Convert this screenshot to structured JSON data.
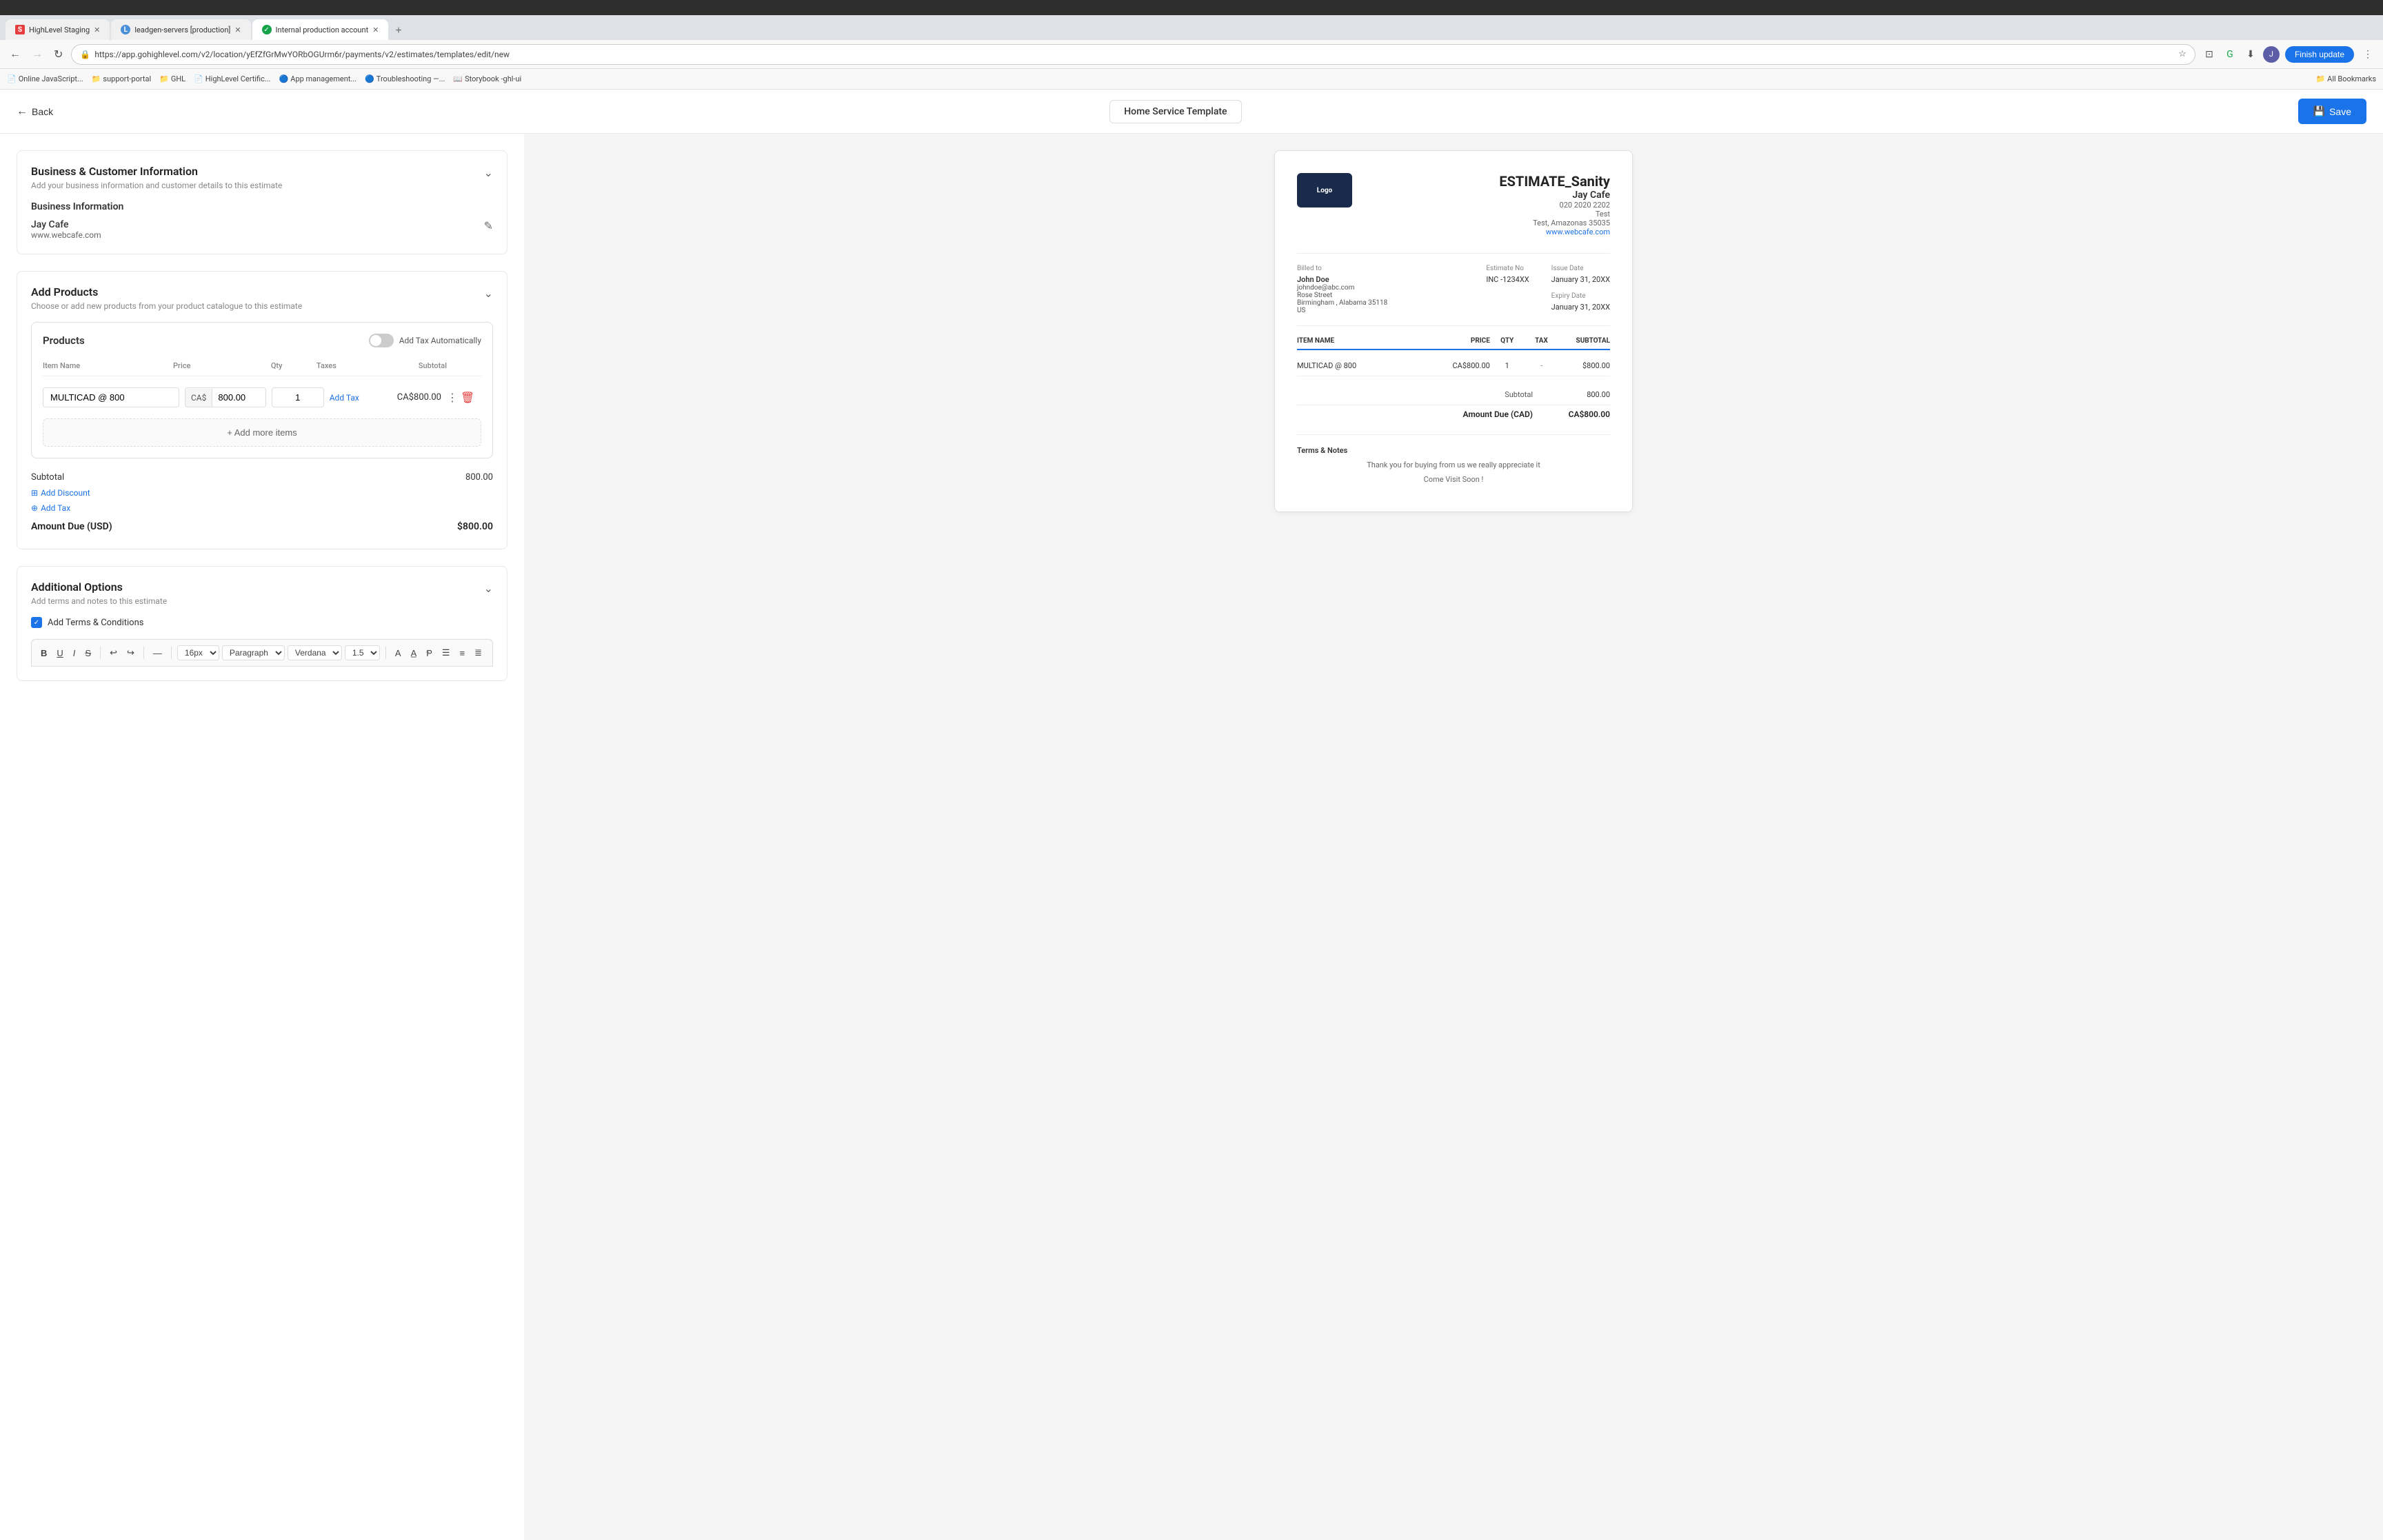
{
  "browser": {
    "tabs": [
      {
        "id": "tab1",
        "favicon": "S",
        "favicon_color": "#e53e3e",
        "label": "HighLevel Staging",
        "active": false
      },
      {
        "id": "tab2",
        "favicon": "L",
        "favicon_color": "#4a90d9",
        "label": "leadgen-servers [production]",
        "active": false
      },
      {
        "id": "tab3",
        "favicon": "✓",
        "favicon_color": "#16a34a",
        "label": "Internal production account",
        "active": true
      }
    ],
    "url": "https://app.gohighlevel.com/v2/location/yEfZfGrMwYORbOGUrm6r/payments/v2/estimates/templates/edit/new",
    "finish_update_label": "Finish update"
  },
  "bookmarks": [
    {
      "label": "Online JavaScript...",
      "icon": "📄"
    },
    {
      "label": "support-portal",
      "icon": "📁"
    },
    {
      "label": "GHL",
      "icon": "📁"
    },
    {
      "label": "HighLevel Certific...",
      "icon": "📄"
    },
    {
      "label": "App management...",
      "icon": "🔵"
    },
    {
      "label": "Troubleshooting —...",
      "icon": "🔵"
    },
    {
      "label": "Storybook -ghl-ui",
      "icon": "📖"
    }
  ],
  "topbar": {
    "back_label": "Back",
    "template_title": "Home Service Template",
    "save_label": "Save"
  },
  "sections": {
    "business_info": {
      "title": "Business & Customer Information",
      "subtitle": "Add your business information and customer details to this estimate",
      "subsection_title": "Business Information",
      "business_name": "Jay Cafe",
      "business_website": "www.webcafe.com"
    },
    "add_products": {
      "title": "Add Products",
      "subtitle": "Choose or add new products from your product catalogue to this estimate",
      "products_title": "Products",
      "toggle_label": "Add Tax Automatically",
      "columns": {
        "item_name": "Item Name",
        "price": "Price",
        "qty": "Qty",
        "taxes": "Taxes",
        "subtotal": "Subtotal"
      },
      "product": {
        "name": "MULTICAD @ 800",
        "currency": "CA$",
        "price": "800.00",
        "qty": "1",
        "add_tax_label": "Add Tax",
        "subtotal": "CA$800.00"
      },
      "add_more_label": "+ Add more items"
    },
    "totals": {
      "subtotal_label": "Subtotal",
      "subtotal_value": "800.00",
      "add_discount_label": "Add Discount",
      "add_tax_label": "Add Tax",
      "amount_due_label": "Amount Due (USD)",
      "amount_due_value": "$800.00"
    },
    "additional_options": {
      "title": "Additional Options",
      "subtitle": "Add terms and notes to this estimate",
      "checkbox_label": "Add Terms & Conditions"
    }
  },
  "editor_toolbar": {
    "buttons": [
      "B",
      "I",
      "U",
      "S",
      "↩",
      "↪",
      "—"
    ],
    "font_size": "16px",
    "paragraph": "Paragraph",
    "font": "Verdana",
    "line_height": "1.5"
  },
  "preview": {
    "title": "ESTIMATE_Sanity",
    "biz_name": "Jay Cafe",
    "biz_phone": "020 2020 2202",
    "biz_city": "Test",
    "biz_address": "Test, Amazonas 35035",
    "biz_website": "www.webcafe.com",
    "billed_to_label": "Billed to",
    "customer_name": "John Doe",
    "customer_email": "johndoe@abc.com",
    "customer_street": "Rose Street",
    "customer_city_state": "Birmingham , Alabama 35118",
    "customer_country": "US",
    "estimate_no_label": "Estimate No",
    "estimate_no": "INC -1234XX",
    "issue_date_label": "Issue Date",
    "issue_date": "January 31, 20XX",
    "expiry_date_label": "Expiry Date",
    "expiry_date": "January 31, 20XX",
    "table": {
      "columns": [
        "ITEM NAME",
        "PRICE",
        "QTY",
        "TAX",
        "SUBTOTAL"
      ],
      "rows": [
        {
          "name": "MULTICAD @ 800",
          "price": "CA$800.00",
          "qty": "1",
          "tax": "-",
          "subtotal": "$800.00"
        }
      ]
    },
    "subtotal_label": "Subtotal",
    "subtotal_value": "800.00",
    "amount_due_label": "Amount Due (CAD)",
    "amount_due_value": "CA$800.00",
    "terms_label": "Terms & Notes",
    "thank_you_text": "Thank you for buying from us we really appreciate it",
    "come_visit_text": "Come Visit Soon !"
  }
}
